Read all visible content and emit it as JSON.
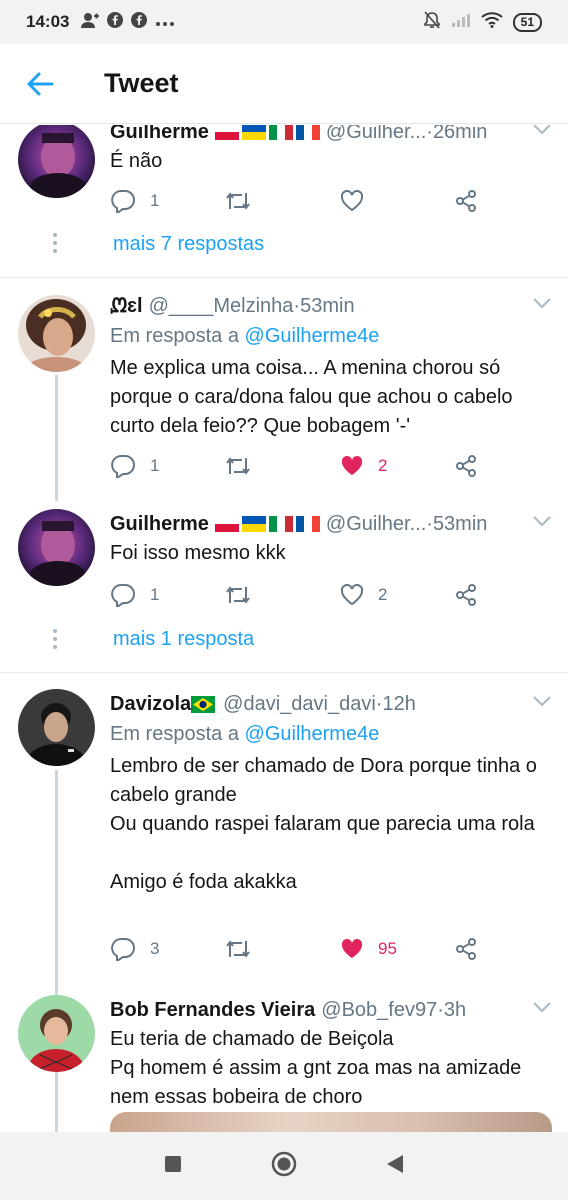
{
  "status": {
    "time": "14:03",
    "battery": "51"
  },
  "header": {
    "title": "Tweet"
  },
  "tweets": [
    {
      "name": "Guilherme",
      "handle": "@Guilher...",
      "time": "26min",
      "text": "É não",
      "replies": "1",
      "retweets": "",
      "likes": ""
    },
    {
      "name": "ᘻɛl",
      "handle": "@____Melzinha",
      "time": "53min",
      "reply_prefix": "Em resposta a ",
      "reply_to": "@Guilherme4e",
      "text": "Me explica uma coisa... A menina chorou só porque o cara/dona falou que achou o cabelo curto dela feio?? Que bobagem '-'",
      "replies": "1",
      "retweets": "",
      "likes": "2"
    },
    {
      "name": "Guilherme",
      "handle": "@Guilher...",
      "time": "53min",
      "text": "Foi isso mesmo kkk",
      "replies": "1",
      "retweets": "",
      "likes": "2"
    },
    {
      "name": "Davizola",
      "handle": "@davi_davi_davi",
      "time": "12h",
      "reply_prefix": "Em resposta a ",
      "reply_to": "@Guilherme4e",
      "text": "Lembro de ser chamado de Dora porque tinha o cabelo grande\nOu quando raspei falaram que parecia uma rola\n\nAmigo é foda akakka",
      "replies": "3",
      "retweets": "",
      "likes": "95"
    },
    {
      "name": "Bob Fernandes Vieira",
      "handle": "@Bob_fev97",
      "time": "3h",
      "text": "Eu teria de chamado de Beiçola\nPq homem é assim a gnt zoa mas na amizade nem essas bobeira de choro"
    }
  ],
  "more_replies": [
    "mais 7 respostas",
    "mais 1 resposta"
  ],
  "separator": " · ",
  "colors": {
    "accent": "#1da1f2",
    "like": "#e0245e",
    "muted": "#657786"
  }
}
